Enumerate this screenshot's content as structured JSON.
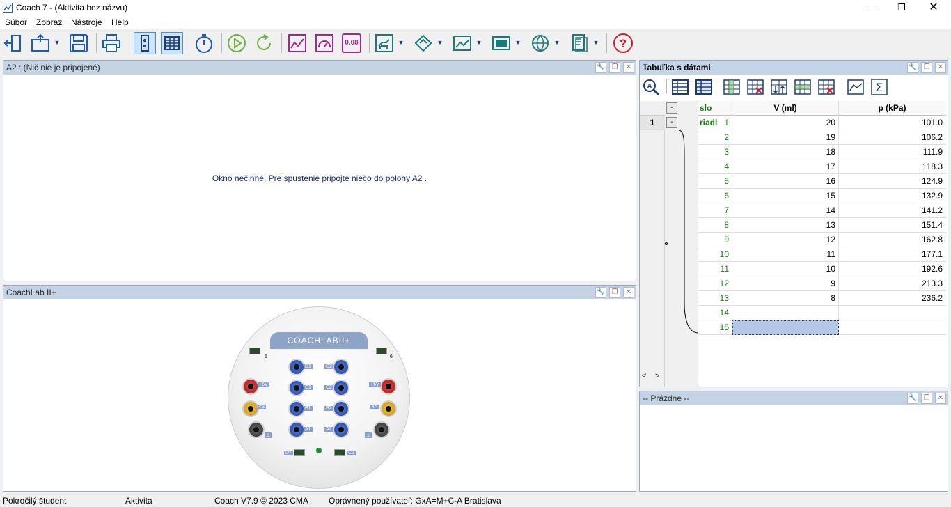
{
  "window": {
    "title": "Coach 7 - (Aktivita bez názvu)"
  },
  "menu": [
    "Súbor",
    "Zobraz",
    "Nástroje",
    "Help"
  ],
  "panel_a2": {
    "title": "A2 : (Nič nie je pripojené)",
    "message": "Okno nečinné. Pre spustenie pripojte niečo do polohy A2 ."
  },
  "panel_coachlab": {
    "title": "CoachLab II+",
    "logo": "COACHLABII+",
    "labels": {
      "p5": "5",
      "p6": "6",
      "v5l": "+5V",
      "v5r": "+5V",
      "d1": "D1",
      "c1": "C1",
      "b1": "B1",
      "a1": "A1",
      "d2": "D2",
      "c2": "C2",
      "b2": "B2",
      "a2": "A2",
      "i3": "<3",
      "i4": "4>",
      "gnd1": "⊥",
      "gnd2": "⊥",
      "d7": "D7",
      "c2b": "C2"
    }
  },
  "panel_table": {
    "title": "Tabuľka s dátami",
    "set_label": "1",
    "collapse_label": "-",
    "columns": [
      "slo riadl",
      "V (ml)",
      "p (kPa)"
    ],
    "rows": [
      {
        "n": "1",
        "v": "20",
        "p": "101.0"
      },
      {
        "n": "2",
        "v": "19",
        "p": "106.2"
      },
      {
        "n": "3",
        "v": "18",
        "p": "111.9"
      },
      {
        "n": "4",
        "v": "17",
        "p": "118.3"
      },
      {
        "n": "5",
        "v": "16",
        "p": "124.9"
      },
      {
        "n": "6",
        "v": "15",
        "p": "132.9"
      },
      {
        "n": "7",
        "v": "14",
        "p": "141.2"
      },
      {
        "n": "8",
        "v": "13",
        "p": "151.4"
      },
      {
        "n": "9",
        "v": "12",
        "p": "162.8"
      },
      {
        "n": "10",
        "v": "11",
        "p": "177.1"
      },
      {
        "n": "11",
        "v": "10",
        "p": "192.6"
      },
      {
        "n": "12",
        "v": "9",
        "p": "213.3"
      },
      {
        "n": "13",
        "v": "8",
        "p": "236.2"
      },
      {
        "n": "14",
        "v": "",
        "p": ""
      },
      {
        "n": "15",
        "v": "",
        "p": ""
      }
    ],
    "scroll_left": "<",
    "scroll_right": ">"
  },
  "panel_empty": {
    "title": "-- Prázdne --"
  },
  "toolbar": {
    "value_display": "0.08"
  },
  "status": {
    "user": "Pokročilý študent",
    "mode": "Aktivita",
    "version": "Coach V7.9 © 2023 CMA",
    "license": "Oprávnený používateľ: GxA=M+C-A Bratislava"
  },
  "colors": {
    "accent": "#2b5ea7",
    "panel_header": "#c5d4e4",
    "selected_cell": "#b5c7e6",
    "row_number": "#1a7a1a",
    "help": "#d11a2a"
  }
}
